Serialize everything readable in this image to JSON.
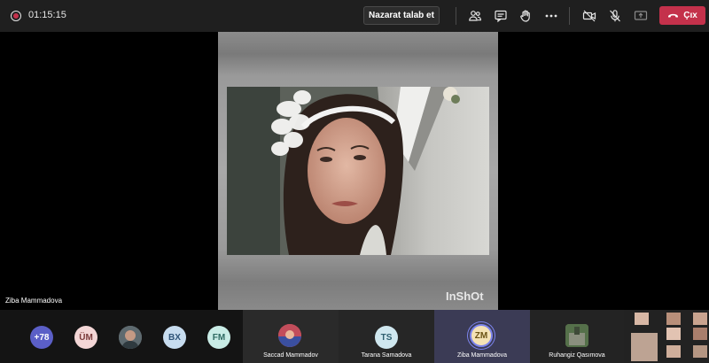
{
  "meeting": {
    "elapsed_time": "01:15:15",
    "request_control_label": "Nazarat talab et",
    "leave_label": "Çıx"
  },
  "toolbar_icons": [
    "participants-icon",
    "chat-icon",
    "raise-hand-icon",
    "more-options-icon",
    "camera-off-icon",
    "mic-off-icon",
    "share-screen-icon",
    "phone-hangup-icon"
  ],
  "stage": {
    "speaker_name": "Ziba Mammadova",
    "shared_content_watermark": "InShOt"
  },
  "strip": {
    "overflow_count": "+78",
    "avatars": [
      {
        "initials": "ÜM",
        "bg": "#f3d6d6",
        "fg": "#7a3b3b"
      },
      {
        "initials": "BX",
        "bg": "#c7dcef",
        "fg": "#2f5478"
      },
      {
        "initials": "FM",
        "bg": "#c9ece6",
        "fg": "#2f6a62"
      },
      {
        "initials": "TS",
        "bg": "#cfe7ef",
        "fg": "#2e5e6e"
      },
      {
        "initials": "ZM",
        "bg": "#f4e2b5",
        "fg": "#6b5315"
      }
    ],
    "tiles": [
      {
        "name": "Saccad Mammadov"
      },
      {
        "name": "Tarana Samadova"
      },
      {
        "name": "Ziba Mammadova"
      },
      {
        "name": "Ruhangiz Qasımova"
      }
    ]
  },
  "colors": {
    "accent_red": "#c4314b",
    "speaking_ring": "#7b83eb",
    "toolbar_bg": "#1f1f1f"
  }
}
